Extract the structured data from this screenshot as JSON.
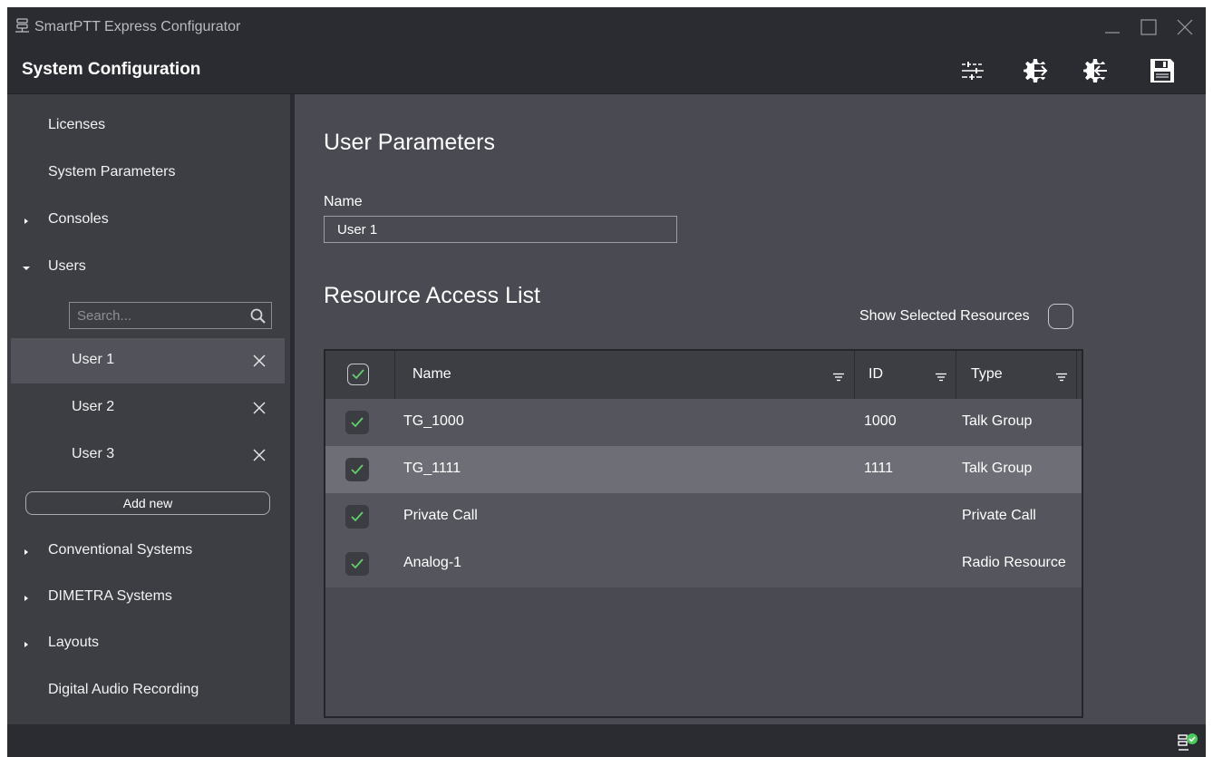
{
  "app": {
    "title": "SmartPTT Express Configurator",
    "icon": "server-icon"
  },
  "window_controls": [
    "minimize-icon",
    "maximize-icon",
    "close-icon"
  ],
  "header": {
    "title": "System Configuration",
    "tools": [
      "settings-sliders-icon",
      "import-config-icon",
      "export-config-icon",
      "save-icon"
    ]
  },
  "sidebar": {
    "items": [
      {
        "label": "Licenses",
        "expander": "none"
      },
      {
        "label": "System Parameters",
        "expander": "none"
      },
      {
        "label": "Consoles",
        "expander": "collapsed"
      },
      {
        "label": "Users",
        "expander": "expanded"
      },
      {
        "label": "Conventional Systems",
        "expander": "collapsed"
      },
      {
        "label": "DIMETRA Systems",
        "expander": "collapsed"
      },
      {
        "label": "Layouts",
        "expander": "collapsed"
      },
      {
        "label": "Digital Audio Recording",
        "expander": "none"
      }
    ],
    "search_placeholder": "Search...",
    "users": [
      {
        "label": "User 1",
        "selected": true
      },
      {
        "label": "User 2",
        "selected": false
      },
      {
        "label": "User 3",
        "selected": false
      }
    ],
    "add_new_label": "Add new"
  },
  "main": {
    "title": "User Parameters",
    "name_label": "Name",
    "name_value": "User 1",
    "section_title": "Resource Access List",
    "show_selected_label": "Show Selected Resources",
    "show_selected_checked": false,
    "columns": [
      "Name",
      "ID",
      "Type"
    ],
    "header_checked": true,
    "rows": [
      {
        "name": "TG_1000",
        "id": "1000",
        "type": "Talk Group",
        "checked": true,
        "selected": false
      },
      {
        "name": "TG_1111",
        "id": "1111",
        "type": "Talk Group",
        "checked": true,
        "selected": true
      },
      {
        "name": "Private Call",
        "id": "",
        "type": "Private Call",
        "checked": true,
        "selected": false
      },
      {
        "name": "Analog-1",
        "id": "",
        "type": "Radio Resource",
        "checked": true,
        "selected": false
      }
    ]
  },
  "colors": {
    "check_green": "#5fd16a",
    "status_green": "#4cc95a"
  },
  "status": {
    "icon": "connection-ok-icon"
  }
}
